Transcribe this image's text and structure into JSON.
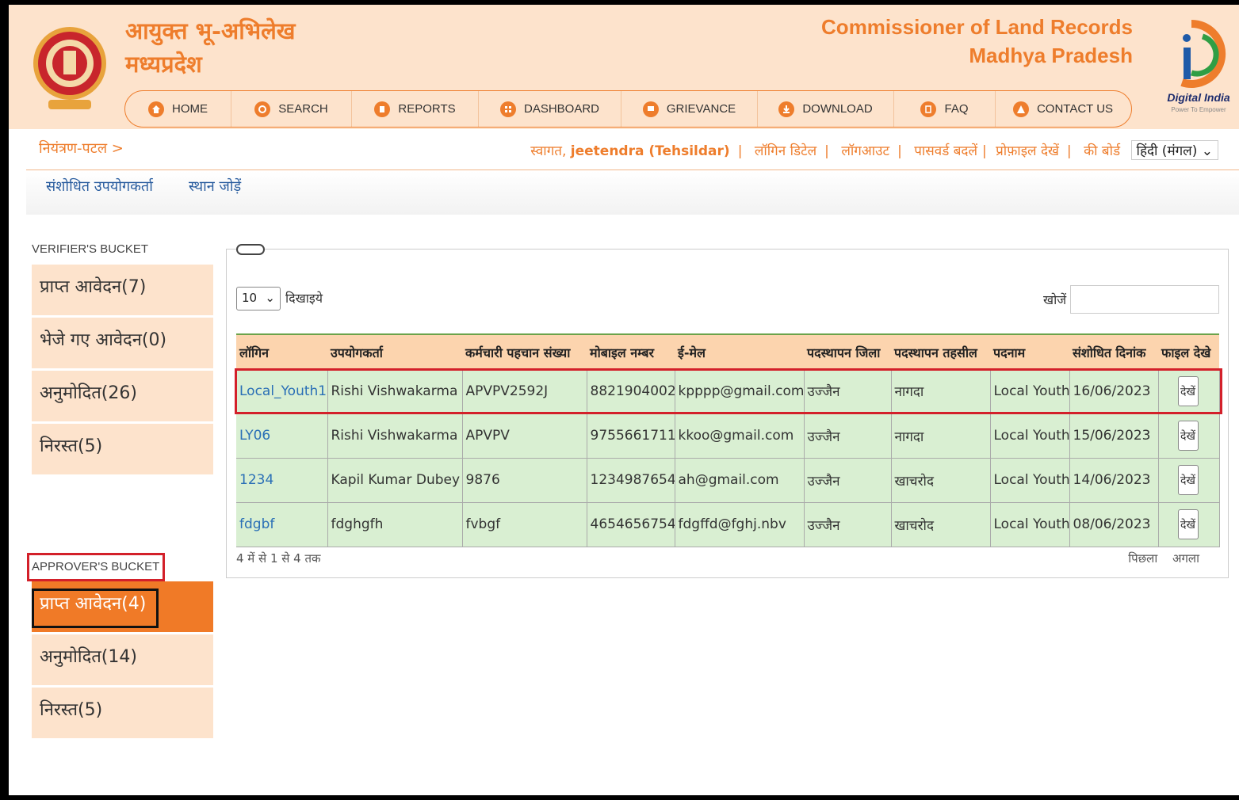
{
  "header": {
    "title_hi_line1": "आयुक्त भू-अभिलेख",
    "title_hi_line2": "मध्यप्रदेश",
    "title_en_line1": "Commissioner of Land Records",
    "title_en_line2": "Madhya Pradesh",
    "digital_india": "Digital India",
    "digital_india_tagline": "Power To Empower"
  },
  "nav": [
    {
      "label": "HOME",
      "icon": "home-icon"
    },
    {
      "label": "SEARCH",
      "icon": "search-icon"
    },
    {
      "label": "REPORTS",
      "icon": "report-icon"
    },
    {
      "label": "DASHBOARD",
      "icon": "dashboard-icon"
    },
    {
      "label": "GRIEVANCE",
      "icon": "grievance-icon"
    },
    {
      "label": "DOWNLOAD",
      "icon": "download-icon"
    },
    {
      "label": "FAQ",
      "icon": "faq-icon"
    },
    {
      "label": "CONTACT US",
      "icon": "contact-icon"
    }
  ],
  "breadcrumb": "नियंत्रण-पटल >",
  "userbar": {
    "welcome": "स्वागत,",
    "user": "jeetendra (Tehsildar)",
    "login_details": "लॉगिन डिटेल",
    "logout": "लॉगआउट",
    "change_password": "पासवर्ड बदलें",
    "view_profile": "प्रोफ़ाइल देखें",
    "keyboard": "की बोर्ड",
    "language": "हिंदी (मंगल)"
  },
  "menu": {
    "modified_users": "संशोधित उपयोगकर्ता",
    "add_location": "स्थान जोड़ें"
  },
  "verifier": {
    "title": "VERIFIER'S BUCKET",
    "items": [
      "प्राप्त आवेदन(7)",
      "भेजे गए आवेदन(0)",
      "अनुमोदित(26)",
      "निरस्त(5)"
    ]
  },
  "approver": {
    "title": "APPROVER'S BUCKET",
    "items": [
      "प्राप्त आवेदन(4)",
      "अनुमोदित(14)",
      "निरस्त(5)"
    ]
  },
  "table": {
    "length_value": "10",
    "length_label": "दिखाइये",
    "search_label": "खोजें",
    "columns": [
      "लॉगिन",
      "उपयोगकर्ता",
      "कर्मचारी पहचान संख्या",
      "मोबाइल नम्बर",
      "ई-मेल",
      "पदस्थापन जिला",
      "पदस्थापन तहसील",
      "पदनाम",
      "संशोधित दिनांक",
      "फाइल देखे"
    ],
    "rows": [
      [
        "Local_Youth1",
        "Rishi Vishwakarma",
        "APVPV2592J",
        "8821904002",
        "kpppp@gmail.com",
        "उज्जैन",
        "नागदा",
        "Local Youth",
        "16/06/2023",
        "देखें"
      ],
      [
        "LY06",
        "Rishi Vishwakarma",
        "APVPV",
        "9755661711",
        "kkoo@gmail.com",
        "उज्जैन",
        "नागदा",
        "Local Youth",
        "15/06/2023",
        "देखें"
      ],
      [
        "1234",
        "Kapil Kumar Dubey",
        "9876",
        "1234987654",
        "ah@gmail.com",
        "उज्जैन",
        "खाचरोद",
        "Local Youth",
        "14/06/2023",
        "देखें"
      ],
      [
        "fdgbf",
        "fdghgfh",
        "fvbgf",
        "4654656754",
        "fdgffd@fghj.nbv",
        "उज्जैन",
        "खाचरोद",
        "Local Youth",
        "08/06/2023",
        "देखें"
      ]
    ],
    "info": "4 में से 1 से 4 तक",
    "prev": "पिछला",
    "next": "अगला"
  },
  "colors": {
    "accent": "#ee7d2c",
    "header_bg": "#fde3cc",
    "row_bg": "#d9efd2",
    "highlight": "#d3202a"
  }
}
